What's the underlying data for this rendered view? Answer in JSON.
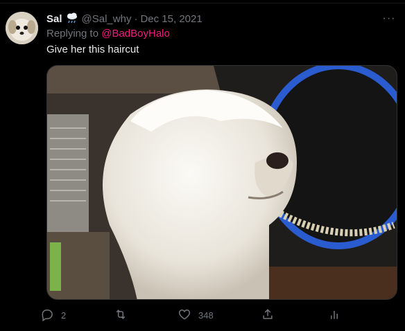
{
  "tweet": {
    "author_name": "Sal",
    "author_emoji": "cloud-rain-icon",
    "author_handle": "@Sal_why",
    "separator": "·",
    "date": "Dec 15, 2021",
    "replying_prefix": "Replying to ",
    "replying_to": "@BadBoyHalo",
    "text": "Give her this haircut",
    "more_label": "···"
  },
  "actions": {
    "reply": {
      "icon": "reply-icon",
      "count": "2"
    },
    "retweet": {
      "icon": "retweet-icon",
      "count": ""
    },
    "like": {
      "icon": "heart-icon",
      "count": "348"
    },
    "share": {
      "icon": "share-icon",
      "count": ""
    },
    "analytics": {
      "icon": "analytics-icon",
      "count": ""
    }
  },
  "colors": {
    "background": "#000000",
    "text_primary": "#e7e9ea",
    "text_secondary": "#71767b",
    "mention": "#f91880"
  }
}
